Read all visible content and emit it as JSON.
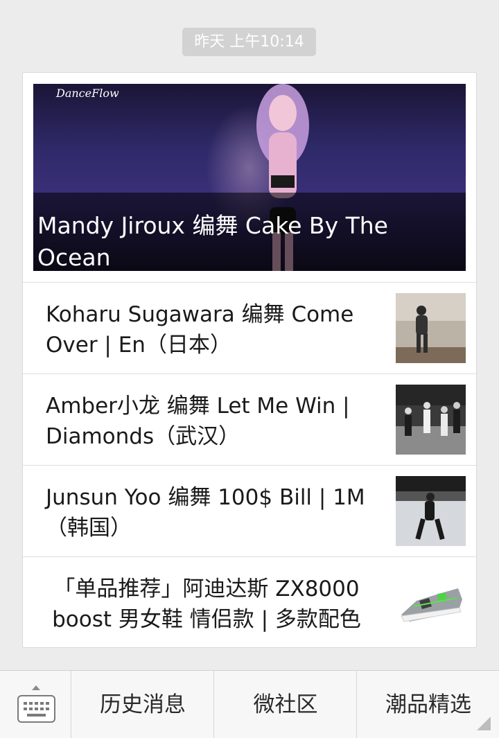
{
  "timestamp": "昨天 上午10:14",
  "hero": {
    "watermark": "DanceFlow",
    "title": "Mandy Jiroux 编舞 Cake By The Ocean"
  },
  "articles": [
    {
      "title": "Koharu Sugawara 编舞 Come Over | En（日本）"
    },
    {
      "title": "Amber小龙 编舞 Let Me Win | Diamonds（武汉）"
    },
    {
      "title": "Junsun Yoo 编舞 100$ Bill | 1M（韩国）"
    },
    {
      "title": "「单品推荐」阿迪达斯 ZX8000 boost  男女鞋 情侣款 | 多款配色"
    }
  ],
  "bottom_menu": {
    "keyboard_icon": "keyboard-icon",
    "items": [
      {
        "label": "历史消息"
      },
      {
        "label": "微社区"
      },
      {
        "label": "潮品精选"
      }
    ]
  },
  "colors": {
    "background": "#ececec",
    "card": "#ffffff",
    "timestamp_bg": "#d2d2d2",
    "bar_bg": "#f7f7f7"
  }
}
